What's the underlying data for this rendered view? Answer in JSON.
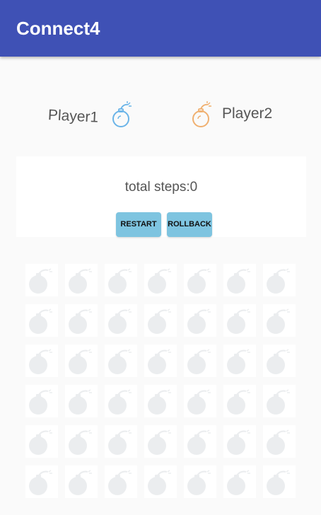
{
  "app_bar": {
    "title": "Connect4",
    "color": "#3f51b5"
  },
  "players": {
    "player1": {
      "label": "Player1",
      "icon": "bomb-icon",
      "icon_color": "#6ab4e8"
    },
    "player2": {
      "label": "Player2",
      "icon": "bomb-icon",
      "icon_color": "#f0b070"
    }
  },
  "status": {
    "steps_text": "total steps:0"
  },
  "buttons": {
    "restart": "RESTART",
    "rollback": "ROLLBACK"
  },
  "board": {
    "rows": 6,
    "columns": 7,
    "cell_icon": "bomb-icon",
    "cell_state": "empty"
  }
}
